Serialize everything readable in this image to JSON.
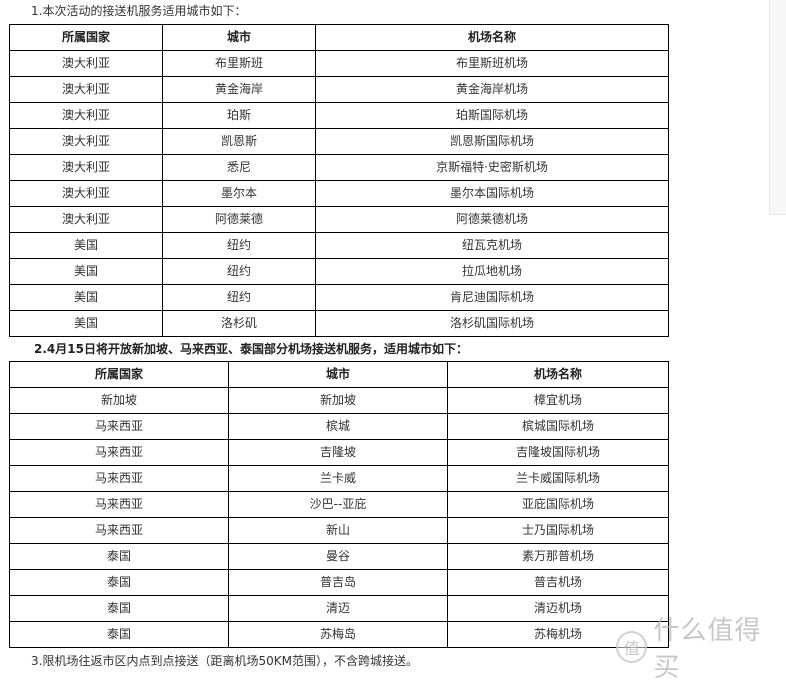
{
  "section1": {
    "title": "1.本次活动的接送机服务适用城市如下：",
    "headers": [
      "所属国家",
      "城市",
      "机场名称"
    ],
    "rows": [
      [
        "澳大利亚",
        "布里斯班",
        "布里斯班机场"
      ],
      [
        "澳大利亚",
        "黄金海岸",
        "黄金海岸机场"
      ],
      [
        "澳大利亚",
        "珀斯",
        "珀斯国际机场"
      ],
      [
        "澳大利亚",
        "凯恩斯",
        "凯恩斯国际机场"
      ],
      [
        "澳大利亚",
        "悉尼",
        "京斯福特·史密斯机场"
      ],
      [
        "澳大利亚",
        "墨尔本",
        "墨尔本国际机场"
      ],
      [
        "澳大利亚",
        "阿德莱德",
        "阿德莱德机场"
      ],
      [
        "美国",
        "纽约",
        "纽瓦克机场"
      ],
      [
        "美国",
        "纽约",
        "拉瓜地机场"
      ],
      [
        "美国",
        "纽约",
        "肯尼迪国际机场"
      ],
      [
        "美国",
        "洛杉矶",
        "洛杉矶国际机场"
      ]
    ]
  },
  "section2": {
    "title": "2.4月15日将开放新加坡、马来西亚、泰国部分机场接送机服务，适用城市如下：",
    "headers": [
      "所属国家",
      "城市",
      "机场名称"
    ],
    "rows": [
      [
        "新加坡",
        "新加坡",
        "樟宜机场"
      ],
      [
        "马来西亚",
        "槟城",
        "槟城国际机场"
      ],
      [
        "马来西亚",
        "吉隆坡",
        "吉隆坡国际机场"
      ],
      [
        "马来西亚",
        "兰卡威",
        "兰卡威国际机场"
      ],
      [
        "马来西亚",
        "沙巴--亚庇",
        "亚庇国际机场"
      ],
      [
        "马来西亚",
        "新山",
        "士乃国际机场"
      ],
      [
        "泰国",
        "曼谷",
        "素万那普机场"
      ],
      [
        "泰国",
        "普吉岛",
        "普吉机场"
      ],
      [
        "泰国",
        "清迈",
        "清迈机场"
      ],
      [
        "泰国",
        "苏梅岛",
        "苏梅机场"
      ]
    ]
  },
  "section3": {
    "text": "3.限机场往返市区内点到点接送（距离机场50KM范围），不含跨城接送。"
  },
  "watermark": {
    "icon_char": "值",
    "text": "什么值得买"
  }
}
